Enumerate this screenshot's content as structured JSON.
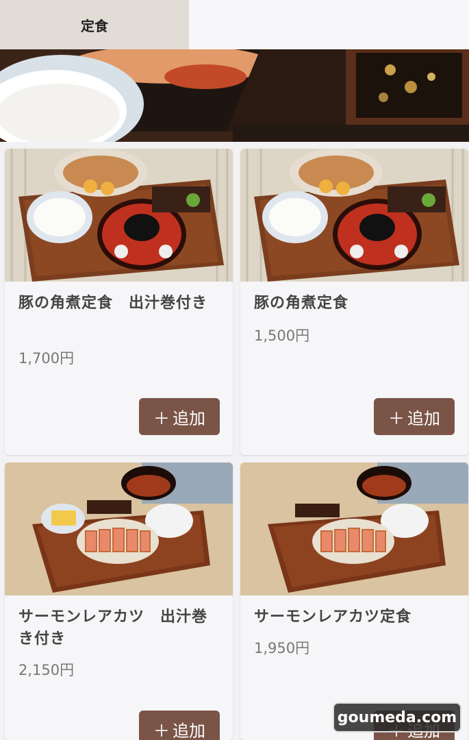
{
  "tabs": [
    {
      "label": "定食",
      "active": true
    },
    {
      "label": "",
      "active": false
    }
  ],
  "menu": [
    {
      "name": "豚の角煮定食　出汁巻付き",
      "price": "1,700円",
      "add_label": "追加",
      "image": "buta-kakuni-teishoku-photo"
    },
    {
      "name": "豚の角煮定食",
      "price": "1,500円",
      "add_label": "追加",
      "image": "buta-kakuni-teishoku-photo"
    },
    {
      "name": "サーモンレアカツ　出汁巻き付き",
      "price": "2,150円",
      "add_label": "追加",
      "image": "salmon-rare-katsu-photo"
    },
    {
      "name": "サーモンレアカツ定食",
      "price": "1,950円",
      "add_label": "追加",
      "image": "salmon-rare-katsu-photo"
    }
  ],
  "watermark": "goumeda.com",
  "colors": {
    "tab_active_bg": "#e2dcd7",
    "button_bg": "#7a5447",
    "page_bg": "#f2f1f3"
  }
}
